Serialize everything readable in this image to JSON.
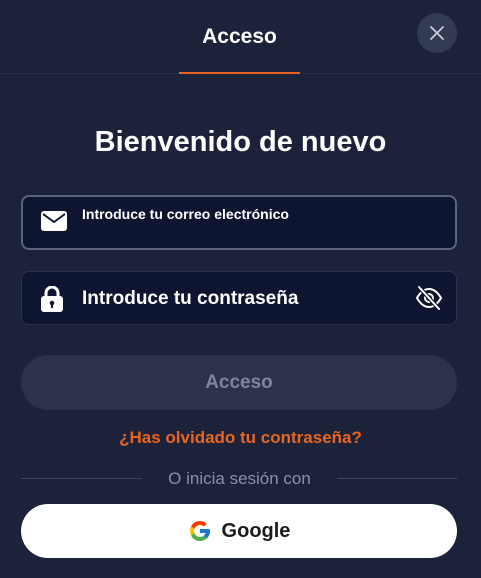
{
  "header": {
    "tab_label": "Acceso",
    "close_icon": "close-icon"
  },
  "title": "Bienvenido de nuevo",
  "email": {
    "icon": "envelope-icon",
    "placeholder": "Introduce tu correo electrónico",
    "value": ""
  },
  "password": {
    "icon": "lock-icon",
    "placeholder": "Introduce tu contraseña",
    "value": "",
    "toggle_icon": "eye-slash-icon"
  },
  "submit_label": "Acceso",
  "forgot_label": "¿Has olvidado tu contraseña?",
  "divider_label": "O inicia sesión con",
  "google": {
    "icon": "google-icon",
    "label": "Google"
  },
  "colors": {
    "background": "#1b2239",
    "accent": "#e8661f",
    "field_background": "#0d1530",
    "disabled_button": "#2b3249"
  }
}
